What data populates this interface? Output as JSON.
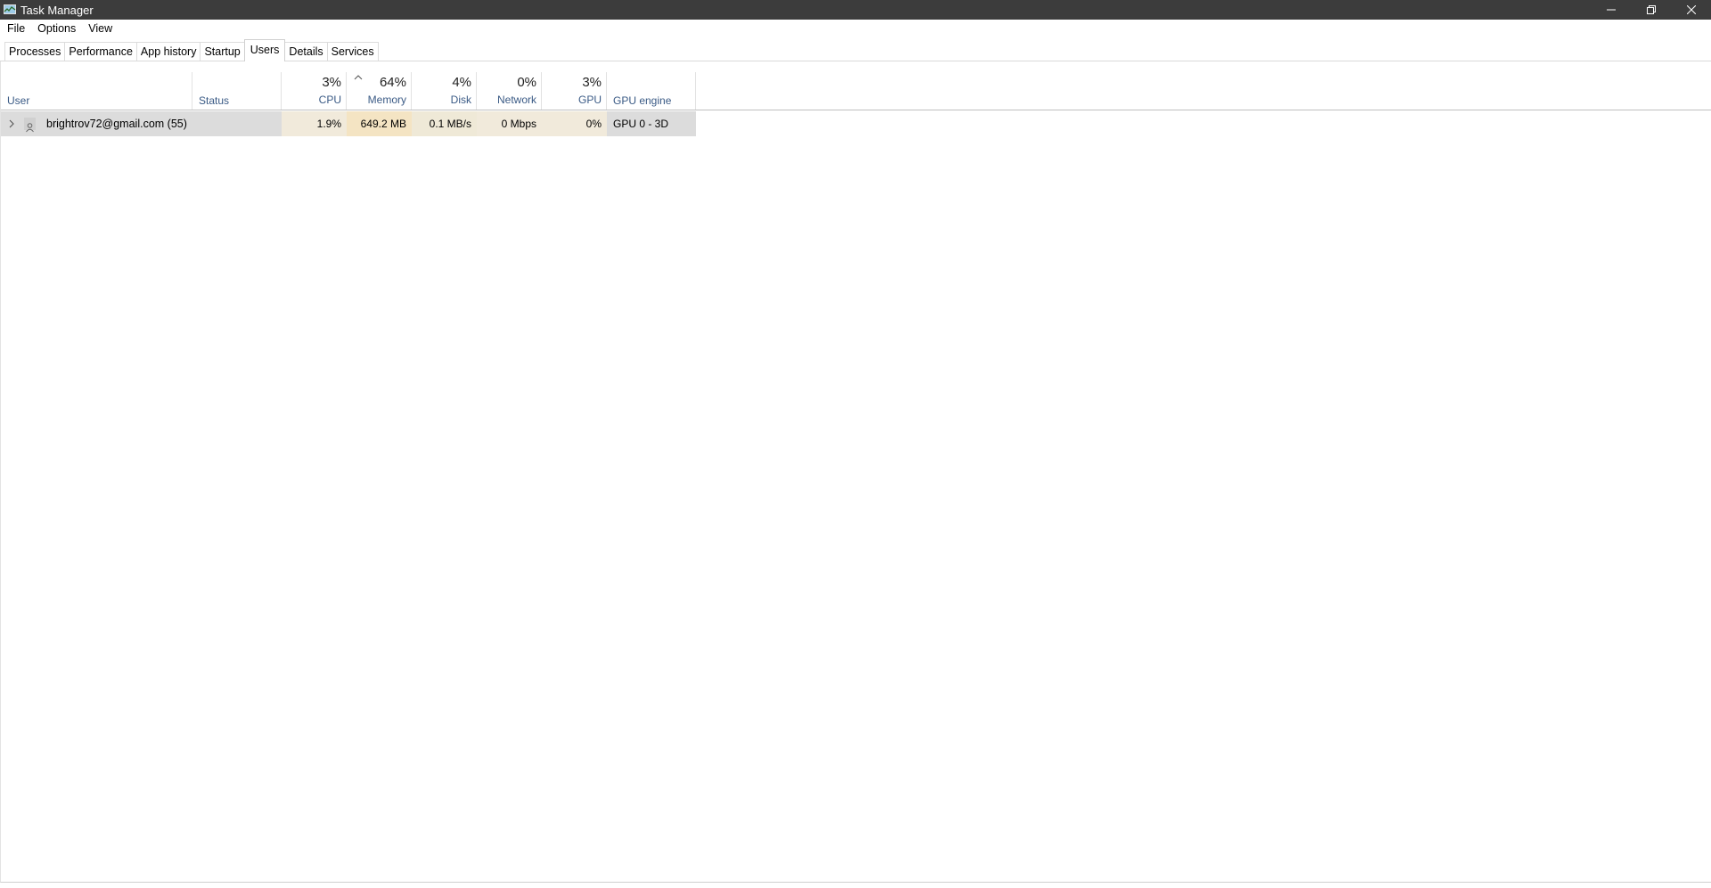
{
  "window": {
    "title": "Task Manager",
    "controls": [
      "minimize",
      "restore",
      "close"
    ]
  },
  "menu": {
    "items": [
      "File",
      "Options",
      "View"
    ]
  },
  "tabs": {
    "items": [
      "Processes",
      "Performance",
      "App history",
      "Startup",
      "Users",
      "Details",
      "Services"
    ],
    "active": "Users"
  },
  "columns": {
    "user": "User",
    "status": "Status",
    "cpu": {
      "percent": "3%",
      "label": "CPU"
    },
    "memory": {
      "percent": "64%",
      "label": "Memory"
    },
    "disk": {
      "percent": "4%",
      "label": "Disk"
    },
    "network": {
      "percent": "0%",
      "label": "Network"
    },
    "gpu": {
      "percent": "3%",
      "label": "GPU"
    },
    "gpu_engine": "GPU engine"
  },
  "rows": [
    {
      "user": "brightrov72@gmail.com (55)",
      "status": "",
      "cpu": "1.9%",
      "memory": "649.2 MB",
      "disk": "0.1 MB/s",
      "network": "0 Mbps",
      "gpu": "0%",
      "gpu_engine": "GPU 0 - 3D"
    }
  ],
  "colors": {
    "titlebar": "#3c3c3c",
    "header_label": "#3a5a85",
    "selected_row": "#dcdcdc",
    "heat_memory": "#f4e4c3"
  }
}
